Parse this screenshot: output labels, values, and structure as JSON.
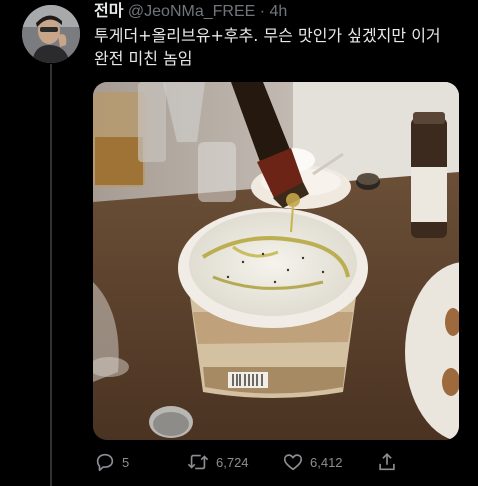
{
  "tweet": {
    "author_name": "전마",
    "handle": "@JeoNMa_FREE",
    "separator": "·",
    "time": "4h",
    "text_line1": "투게더+올리브유+후추. 무슨 맛인가 싶겠지만 이거",
    "text_line2": "완전 미친 놈임"
  },
  "actions": {
    "reply_count": "5",
    "retweet_count": "6,724",
    "like_count": "6,412"
  },
  "icons": {
    "reply": "reply-icon",
    "retweet": "retweet-icon",
    "like": "heart-icon",
    "share": "share-icon"
  },
  "colors": {
    "background": "#000000",
    "text": "#e7e9ea",
    "muted": "#71767b"
  }
}
